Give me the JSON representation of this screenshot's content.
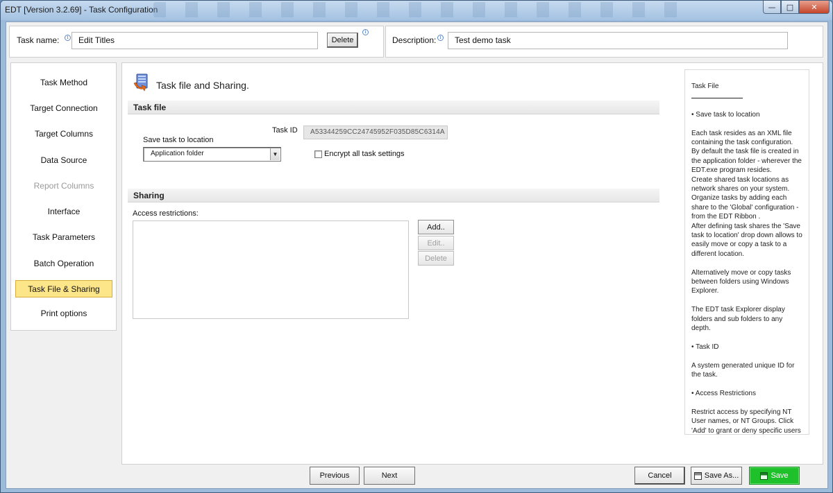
{
  "window": {
    "title": "EDT [Version 3.2.69] - Task Configuration"
  },
  "header": {
    "task_name_label": "Task name:",
    "task_name_value": "Edit Titles",
    "delete_label": "Delete",
    "description_label": "Description:",
    "description_value": "Test demo task"
  },
  "nav": {
    "items": [
      {
        "label": "Task Method"
      },
      {
        "label": "Target Connection"
      },
      {
        "label": "Target Columns"
      },
      {
        "label": "Data Source"
      },
      {
        "label": "Report Columns",
        "state": "disabled"
      },
      {
        "label": "Interface"
      },
      {
        "label": "Task Parameters"
      },
      {
        "label": "Batch Operation"
      },
      {
        "label": "Task File & Sharing",
        "state": "active"
      },
      {
        "label": "Print options"
      }
    ]
  },
  "main": {
    "heading": "Task file and Sharing.",
    "task_file_section": "Task file",
    "task_id_label": "Task ID",
    "task_id_value": "A53344259CC24745952F035D85C6314A",
    "save_location_label": "Save task to location",
    "save_location_value": "Application folder",
    "encrypt_label": "Encrypt all task settings",
    "encrypt_checked": false,
    "sharing_section": "Sharing",
    "access_label": "Access restrictions:",
    "add_label": "Add..",
    "edit_label": "Edit..",
    "delete_label": "Delete"
  },
  "help": {
    "title": "Task File",
    "bullet_save": "• Save task to location",
    "para_1": "Each task resides as an XML file containing the task configuration. By default the task file is created in the application folder - wherever the EDT.exe program resides.\nCreate shared task locations as network shares on your system.\nOrganize tasks by adding each share to the 'Global' configuration - from the EDT Ribbon .\nAfter defining task shares the 'Save task to location' drop down allows to easily move or copy a task to a different location.",
    "para_2": "Alternatively move or copy tasks between folders using Windows Explorer.",
    "para_3": "The EDT task Explorer display folders and sub folders to any depth.",
    "bullet_taskid": "• Task ID",
    "para_4": "A system generated unique ID for the task.",
    "bullet_access": "• Access Restrictions",
    "para_5": "Restrict access by specifying NT User names, or NT Groups.  Click 'Add' to grant or deny specific users or"
  },
  "footer": {
    "previous_label": "Previous",
    "next_label": "Next",
    "cancel_label": "Cancel",
    "save_as_label": "Save As...",
    "save_label": "Save"
  },
  "colors": {
    "active_nav": "#fde58a",
    "save_button": "#1fc12b"
  }
}
